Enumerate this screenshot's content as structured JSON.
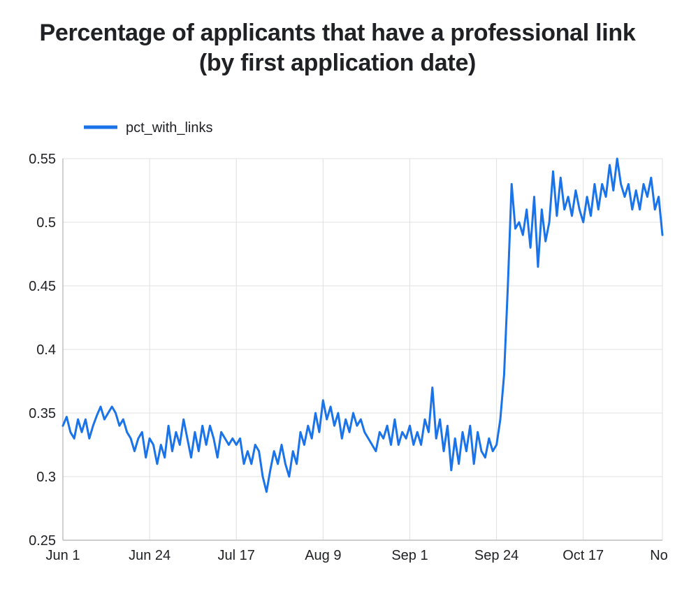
{
  "title": "Percentage of applicants that have a professional link (by first application date)",
  "legend": {
    "series_label": "pct_with_links"
  },
  "colors": {
    "line": "#1a73e8",
    "grid": "#e0e0e0",
    "axis": "#9e9e9e",
    "text": "#202124"
  },
  "chart_data": {
    "type": "line",
    "xlabel": "",
    "ylabel": "",
    "ylim": [
      0.25,
      0.55
    ],
    "x_tick_labels": [
      "Jun 1",
      "Jun 24",
      "Jul 17",
      "Aug 9",
      "Sep 1",
      "Sep 24",
      "Oct 17",
      "Nov"
    ],
    "y_tick_labels": [
      "0.25",
      "0.3",
      "0.35",
      "0.4",
      "0.45",
      "0.5",
      "0.55"
    ],
    "series": [
      {
        "name": "pct_with_links",
        "x": [
          "Jun 1",
          "Jun 2",
          "Jun 3",
          "Jun 4",
          "Jun 5",
          "Jun 6",
          "Jun 7",
          "Jun 8",
          "Jun 9",
          "Jun 10",
          "Jun 11",
          "Jun 12",
          "Jun 13",
          "Jun 14",
          "Jun 15",
          "Jun 16",
          "Jun 17",
          "Jun 18",
          "Jun 19",
          "Jun 20",
          "Jun 21",
          "Jun 22",
          "Jun 23",
          "Jun 24",
          "Jun 25",
          "Jun 26",
          "Jun 27",
          "Jun 28",
          "Jun 29",
          "Jun 30",
          "Jul 1",
          "Jul 2",
          "Jul 3",
          "Jul 4",
          "Jul 5",
          "Jul 6",
          "Jul 7",
          "Jul 8",
          "Jul 9",
          "Jul 10",
          "Jul 11",
          "Jul 12",
          "Jul 13",
          "Jul 14",
          "Jul 15",
          "Jul 16",
          "Jul 17",
          "Jul 18",
          "Jul 19",
          "Jul 20",
          "Jul 21",
          "Jul 22",
          "Jul 23",
          "Jul 24",
          "Jul 25",
          "Jul 26",
          "Jul 27",
          "Jul 28",
          "Jul 29",
          "Jul 30",
          "Jul 31",
          "Aug 1",
          "Aug 2",
          "Aug 3",
          "Aug 4",
          "Aug 5",
          "Aug 6",
          "Aug 7",
          "Aug 8",
          "Aug 9",
          "Aug 10",
          "Aug 11",
          "Aug 12",
          "Aug 13",
          "Aug 14",
          "Aug 15",
          "Aug 16",
          "Aug 17",
          "Aug 18",
          "Aug 19",
          "Aug 20",
          "Aug 21",
          "Aug 22",
          "Aug 23",
          "Aug 24",
          "Aug 25",
          "Aug 26",
          "Aug 27",
          "Aug 28",
          "Aug 29",
          "Aug 30",
          "Aug 31",
          "Sep 1",
          "Sep 2",
          "Sep 3",
          "Sep 4",
          "Sep 5",
          "Sep 6",
          "Sep 7",
          "Sep 8",
          "Sep 9",
          "Sep 10",
          "Sep 11",
          "Sep 12",
          "Sep 13",
          "Sep 14",
          "Sep 15",
          "Sep 16",
          "Sep 17",
          "Sep 18",
          "Sep 19",
          "Sep 20",
          "Sep 21",
          "Sep 22",
          "Sep 23",
          "Sep 24",
          "Sep 25",
          "Sep 26",
          "Sep 27",
          "Sep 28",
          "Sep 29",
          "Sep 30",
          "Oct 1",
          "Oct 2",
          "Oct 3",
          "Oct 4",
          "Oct 5",
          "Oct 6",
          "Oct 7",
          "Oct 8",
          "Oct 9",
          "Oct 10",
          "Oct 11",
          "Oct 12",
          "Oct 13",
          "Oct 14",
          "Oct 15",
          "Oct 16",
          "Oct 17",
          "Oct 18",
          "Oct 19",
          "Oct 20",
          "Oct 21",
          "Oct 22",
          "Oct 23",
          "Oct 24",
          "Oct 25",
          "Oct 26",
          "Oct 27",
          "Oct 28",
          "Oct 29",
          "Oct 30",
          "Oct 31",
          "Nov 1",
          "Nov 2",
          "Nov 3",
          "Nov 4",
          "Nov 5",
          "Nov 6",
          "Nov 7"
        ],
        "values": [
          0.34,
          0.347,
          0.335,
          0.33,
          0.345,
          0.335,
          0.345,
          0.33,
          0.34,
          0.348,
          0.355,
          0.345,
          0.35,
          0.355,
          0.35,
          0.34,
          0.345,
          0.335,
          0.33,
          0.32,
          0.33,
          0.335,
          0.315,
          0.33,
          0.325,
          0.31,
          0.325,
          0.315,
          0.34,
          0.32,
          0.335,
          0.325,
          0.345,
          0.33,
          0.315,
          0.335,
          0.32,
          0.34,
          0.325,
          0.34,
          0.33,
          0.315,
          0.335,
          0.33,
          0.325,
          0.33,
          0.325,
          0.33,
          0.31,
          0.32,
          0.31,
          0.325,
          0.32,
          0.3,
          0.288,
          0.305,
          0.32,
          0.31,
          0.325,
          0.31,
          0.3,
          0.32,
          0.31,
          0.335,
          0.325,
          0.34,
          0.33,
          0.35,
          0.335,
          0.36,
          0.345,
          0.355,
          0.34,
          0.35,
          0.33,
          0.345,
          0.335,
          0.35,
          0.34,
          0.345,
          0.335,
          0.33,
          0.325,
          0.32,
          0.335,
          0.33,
          0.34,
          0.325,
          0.345,
          0.325,
          0.335,
          0.33,
          0.34,
          0.325,
          0.335,
          0.325,
          0.345,
          0.335,
          0.37,
          0.33,
          0.345,
          0.32,
          0.34,
          0.305,
          0.33,
          0.31,
          0.335,
          0.32,
          0.34,
          0.31,
          0.335,
          0.32,
          0.315,
          0.33,
          0.32,
          0.325,
          0.345,
          0.38,
          0.45,
          0.53,
          0.495,
          0.5,
          0.49,
          0.51,
          0.48,
          0.52,
          0.465,
          0.51,
          0.485,
          0.5,
          0.54,
          0.505,
          0.535,
          0.51,
          0.52,
          0.505,
          0.525,
          0.51,
          0.5,
          0.52,
          0.505,
          0.53,
          0.51,
          0.53,
          0.52,
          0.545,
          0.525,
          0.55,
          0.53,
          0.52,
          0.53,
          0.51,
          0.525,
          0.51,
          0.53,
          0.52,
          0.535,
          0.51,
          0.52,
          0.49
        ]
      }
    ]
  }
}
